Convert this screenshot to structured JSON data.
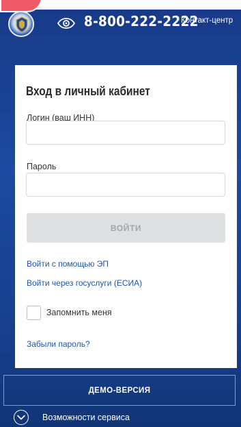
{
  "header": {
    "phone": "8-800-222-2222",
    "contact_label": "Контакт-центр"
  },
  "login": {
    "title": "Вход в личный кабинет",
    "login_label": "Логин (ваш ИНН)",
    "login_value": "",
    "password_label": "Пароль",
    "password_value": "",
    "submit_label": "ВОЙТИ",
    "ep_link": "Войти с помощью ЭП",
    "esia_link": "Войти через госуслуги (ЕСИА)",
    "remember_label": "Запомнить меня",
    "forgot_link": "Забыли пароль?"
  },
  "footer": {
    "demo_label": "ДЕМО-ВЕРСИЯ",
    "features_label": "Возможности сервиса"
  },
  "colors": {
    "background": "#1d4aa0",
    "link": "#1e55b3",
    "disabled_button": "#dfe0e2"
  },
  "icons": {
    "logo": "fns-emblem-icon",
    "accessibility": "eye-icon",
    "expand": "chevron-down-icon"
  }
}
